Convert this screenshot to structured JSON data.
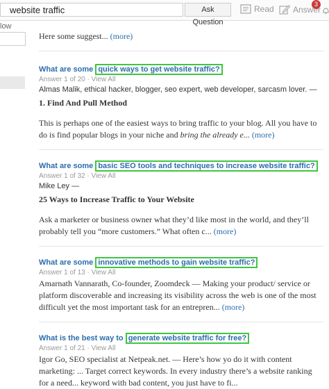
{
  "header": {
    "search_value": "website traffic",
    "ask_label": "Ask Question",
    "read_label": "Read",
    "answer_label": "Answer",
    "notification_count": "3"
  },
  "sidebar": {
    "follow_fragment": "low"
  },
  "intro": {
    "text": "Here some suggest... ",
    "more": "(more)"
  },
  "questions": [
    {
      "prefix": "What are some ",
      "highlight": "quick ways to get website traffic?",
      "meta": "Answer 1 of 20 · View All",
      "author": "Almas Malik, ethical hacker, blogger, seo expert, web developer, sarcasm lover. —",
      "headline": "1. Find And Pull Method",
      "body_1": "This is perhaps one of the easiest ways to bring traffic to your blog. All you have to do is find popular blogs in your niche and ",
      "body_italic": "bring the already e...",
      "more": "(more)"
    },
    {
      "prefix": "What are some ",
      "highlight": "basic SEO tools and techniques to increase website traffic?",
      "meta": "Answer 1 of 32 · View All",
      "author": "Mike Ley —",
      "headline": "25 Ways to Increase Traffic to Your Website",
      "body_1": "Ask a marketer or business owner what they’d like most in the world, and they’ll probably tell you “more customers.” What often c... ",
      "body_italic": "",
      "more": "(more)"
    },
    {
      "prefix": "What are some ",
      "highlight": "innovative methods to gain website traffic?",
      "meta": "Answer 1 of 13 · View All",
      "author": "",
      "headline": "",
      "body_1": "Amarnath Vannarath, Co-founder, Zoomdeck — Making your product/ service or platform discoverable and increasing its visibility across the web is one of the most difficult yet the most important task for an entrepren... ",
      "body_italic": "",
      "more": "(more)"
    },
    {
      "prefix": "What is the best way to ",
      "highlight": "generate website traffic for free?",
      "meta": "Answer 1 of 21 · View All",
      "author": "",
      "headline": "",
      "body_1": "Igor Go, SEO specialist at Netpeak.net. — Here’s how yo do it with content marketing: ... Target correct keywords. In every industry there’s a website ranking for a need... keyword with bad content, you just have to fi...",
      "body_italic": "",
      "more": ""
    }
  ]
}
